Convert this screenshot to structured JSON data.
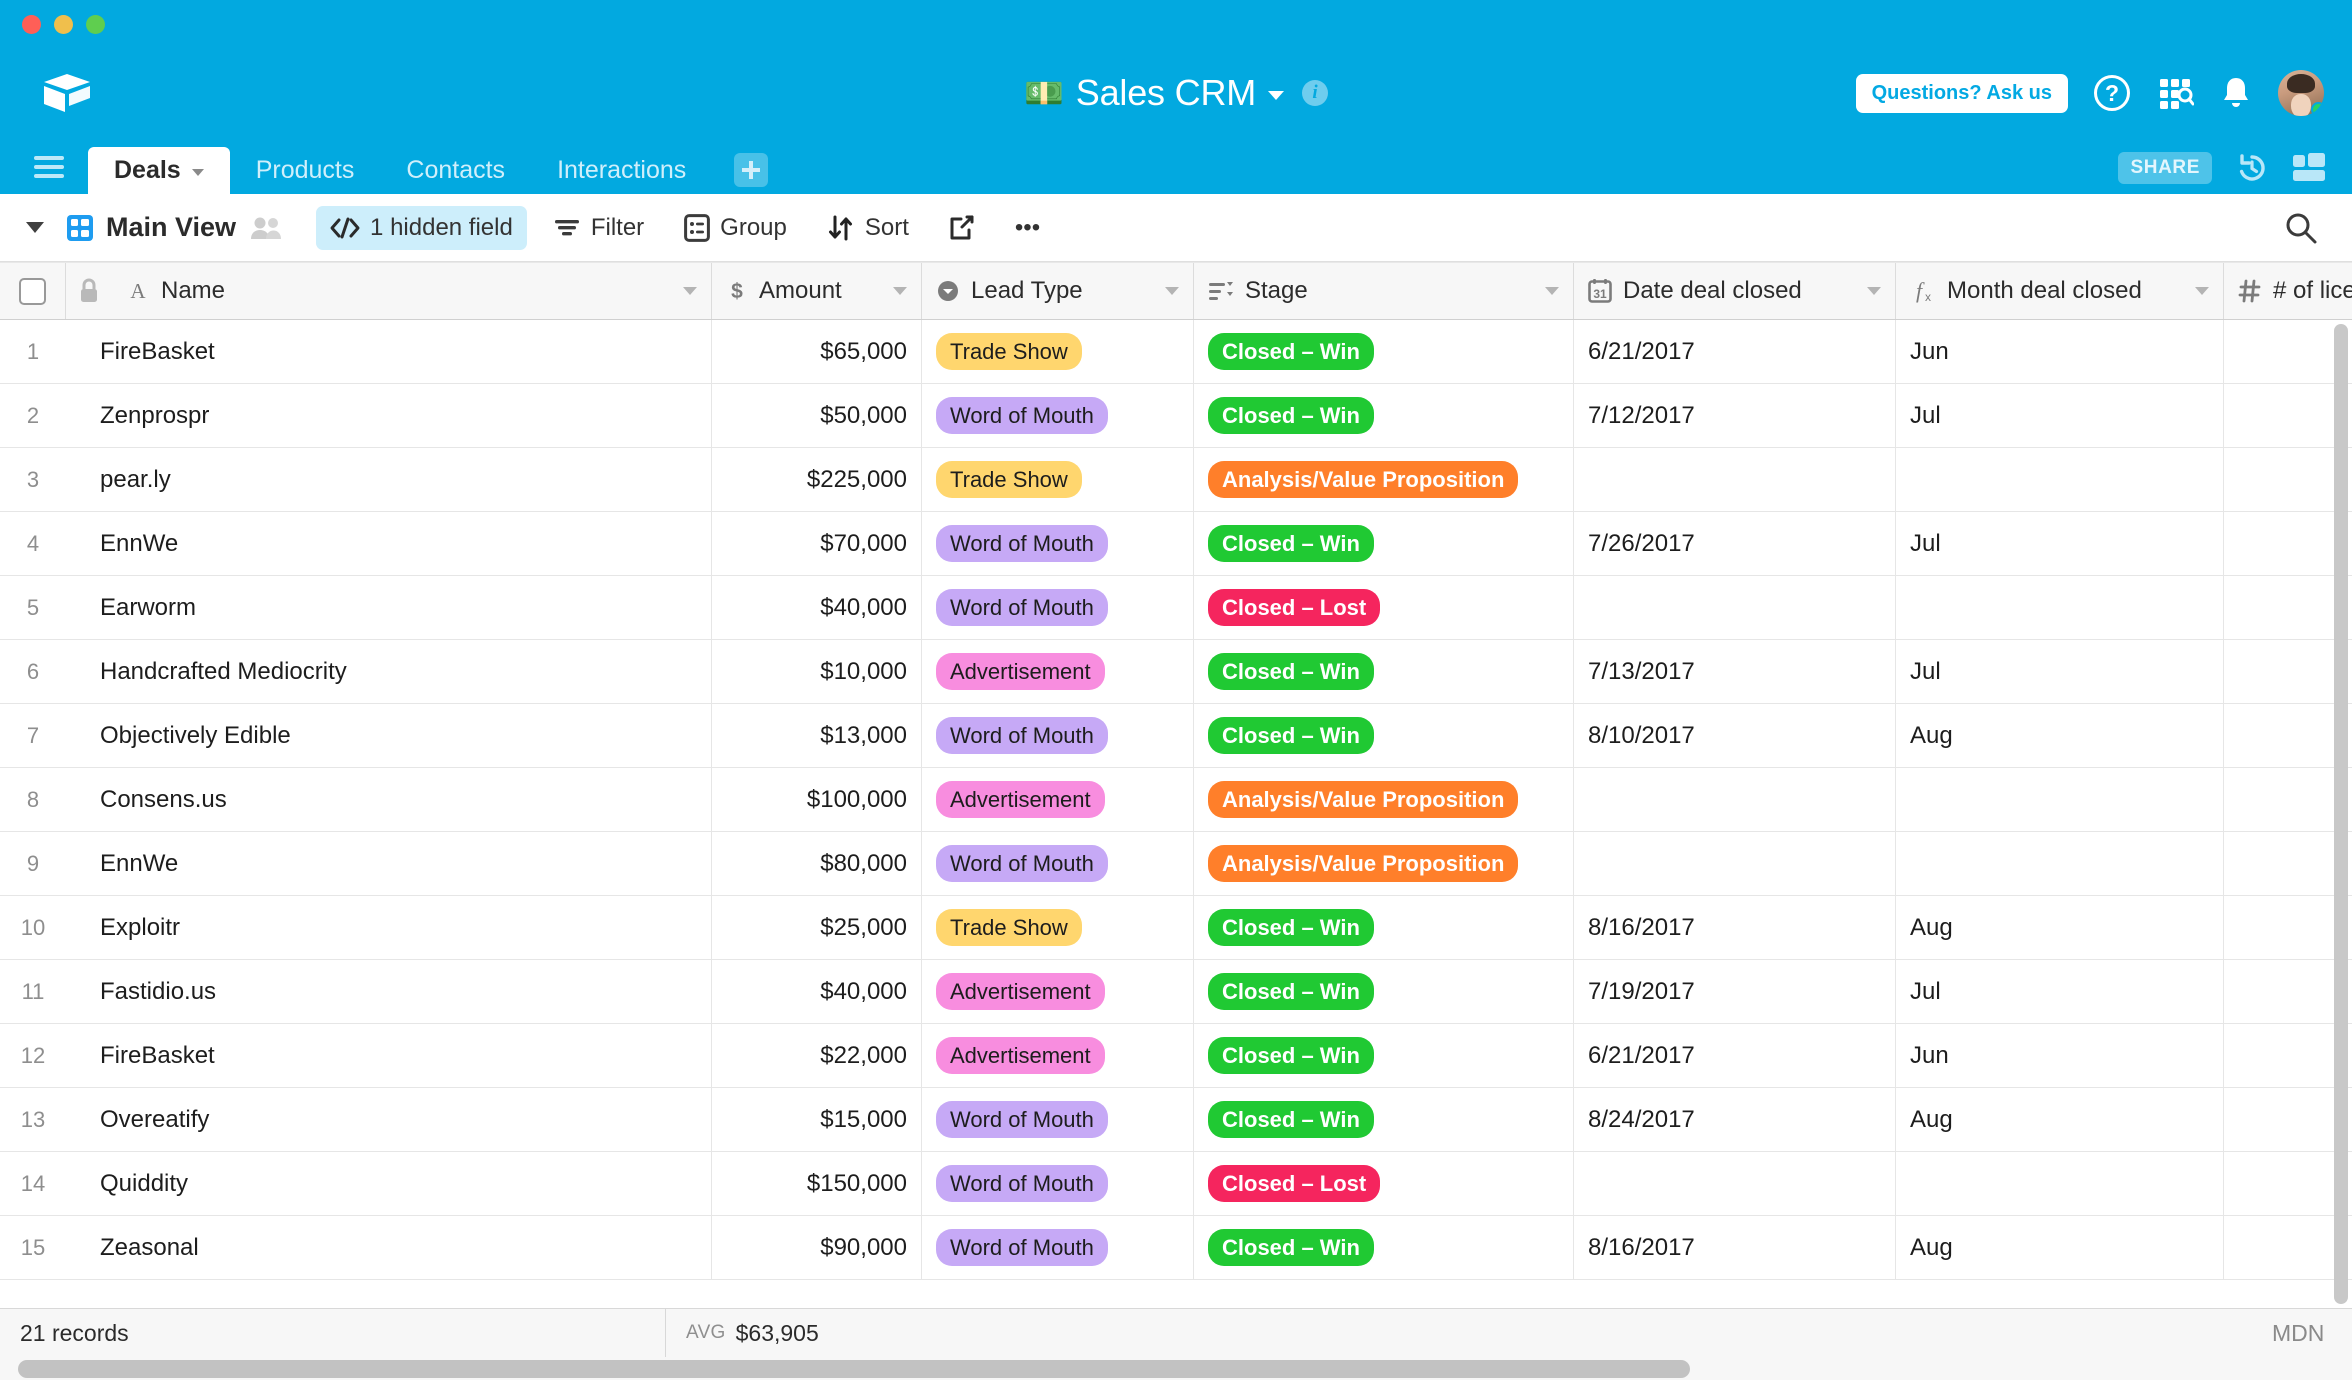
{
  "window": {
    "traffic_lights": [
      "close",
      "minimize",
      "maximize"
    ]
  },
  "header": {
    "logo": "airtable-logo",
    "base_title": "Sales CRM",
    "base_emoji": "💵",
    "info_icon": "info-icon",
    "ask_button": "Questions? Ask us",
    "help_icon": "?",
    "apps_icon": "apps-search-icon",
    "bell_icon": "notifications-icon",
    "avatar": "user-avatar",
    "avatar_status": "online"
  },
  "tabs": {
    "items": [
      {
        "label": "Deals",
        "active": true,
        "has_caret": true
      },
      {
        "label": "Products",
        "active": false,
        "has_caret": false
      },
      {
        "label": "Contacts",
        "active": false,
        "has_caret": false
      },
      {
        "label": "Interactions",
        "active": false,
        "has_caret": false
      }
    ],
    "add_label": "+",
    "share_label": "SHARE",
    "history_icon": "history-icon",
    "blocks_icon": "blocks-icon",
    "menu_icon": "hamburger-menu-icon"
  },
  "viewbar": {
    "view_name": "Main View",
    "hidden_field": "1 hidden field",
    "filter": "Filter",
    "group": "Group",
    "sort": "Sort",
    "share_view_icon": "share-view-icon",
    "more": "•••",
    "search_icon": "search-icon"
  },
  "grid": {
    "columns": [
      {
        "label": "Name",
        "type_icon": "text-field-icon",
        "locked": true
      },
      {
        "label": "Amount",
        "type_icon": "currency-field-icon"
      },
      {
        "label": "Lead Type",
        "type_icon": "single-select-field-icon"
      },
      {
        "label": "Stage",
        "type_icon": "multi-select-field-icon"
      },
      {
        "label": "Date deal closed",
        "type_icon": "date-field-icon"
      },
      {
        "label": "Month deal closed",
        "type_icon": "formula-field-icon"
      },
      {
        "label": "# of licenses",
        "type_icon": "number-field-icon"
      }
    ],
    "rows": [
      {
        "num": "1",
        "name": "FireBasket",
        "amount": "$65,000",
        "lead": "Trade Show",
        "stage": "Closed – Win",
        "date": "6/21/2017",
        "month": "Jun",
        "licenses": ""
      },
      {
        "num": "2",
        "name": "Zenprospr",
        "amount": "$50,000",
        "lead": "Word of Mouth",
        "stage": "Closed – Win",
        "date": "7/12/2017",
        "month": "Jul",
        "licenses": ""
      },
      {
        "num": "3",
        "name": "pear.ly",
        "amount": "$225,000",
        "lead": "Trade Show",
        "stage": "Analysis/Value Proposition",
        "date": "",
        "month": "",
        "licenses": ""
      },
      {
        "num": "4",
        "name": "EnnWe",
        "amount": "$70,000",
        "lead": "Word of Mouth",
        "stage": "Closed – Win",
        "date": "7/26/2017",
        "month": "Jul",
        "licenses": ""
      },
      {
        "num": "5",
        "name": "Earworm",
        "amount": "$40,000",
        "lead": "Word of Mouth",
        "stage": "Closed – Lost",
        "date": "",
        "month": "",
        "licenses": ""
      },
      {
        "num": "6",
        "name": "Handcrafted Mediocrity",
        "amount": "$10,000",
        "lead": "Advertisement",
        "stage": "Closed – Win",
        "date": "7/13/2017",
        "month": "Jul",
        "licenses": ""
      },
      {
        "num": "7",
        "name": "Objectively Edible",
        "amount": "$13,000",
        "lead": "Word of Mouth",
        "stage": "Closed – Win",
        "date": "8/10/2017",
        "month": "Aug",
        "licenses": ""
      },
      {
        "num": "8",
        "name": "Consens.us",
        "amount": "$100,000",
        "lead": "Advertisement",
        "stage": "Analysis/Value Proposition",
        "date": "",
        "month": "",
        "licenses": ""
      },
      {
        "num": "9",
        "name": "EnnWe",
        "amount": "$80,000",
        "lead": "Word of Mouth",
        "stage": "Analysis/Value Proposition",
        "date": "",
        "month": "",
        "licenses": ""
      },
      {
        "num": "10",
        "name": "Exploitr",
        "amount": "$25,000",
        "lead": "Trade Show",
        "stage": "Closed – Win",
        "date": "8/16/2017",
        "month": "Aug",
        "licenses": ""
      },
      {
        "num": "11",
        "name": "Fastidio.us",
        "amount": "$40,000",
        "lead": "Advertisement",
        "stage": "Closed – Win",
        "date": "7/19/2017",
        "month": "Jul",
        "licenses": ""
      },
      {
        "num": "12",
        "name": "FireBasket",
        "amount": "$22,000",
        "lead": "Advertisement",
        "stage": "Closed – Win",
        "date": "6/21/2017",
        "month": "Jun",
        "licenses": ""
      },
      {
        "num": "13",
        "name": "Overeatify",
        "amount": "$15,000",
        "lead": "Word of Mouth",
        "stage": "Closed – Win",
        "date": "8/24/2017",
        "month": "Aug",
        "licenses": ""
      },
      {
        "num": "14",
        "name": "Quiddity",
        "amount": "$150,000",
        "lead": "Word of Mouth",
        "stage": "Closed – Lost",
        "date": "",
        "month": "",
        "licenses": ""
      },
      {
        "num": "15",
        "name": "Zeasonal",
        "amount": "$90,000",
        "lead": "Word of Mouth",
        "stage": "Closed – Win",
        "date": "8/16/2017",
        "month": "Aug",
        "licenses": ""
      }
    ]
  },
  "footer": {
    "records": "21 records",
    "avg_label": "AVG",
    "avg_value": "$63,905",
    "right_text": "MDN"
  },
  "colors": {
    "brand_blue": "#02a9e0",
    "lead_trade_show": "#ffd66e",
    "lead_word_of_mouth": "#c6a9f6",
    "lead_advertisement": "#f88ddf",
    "stage_closed_win": "#20c933",
    "stage_closed_lost": "#f5255e",
    "stage_analysis": "#ff7f2a",
    "highlight_blue": "#cdeefb"
  }
}
